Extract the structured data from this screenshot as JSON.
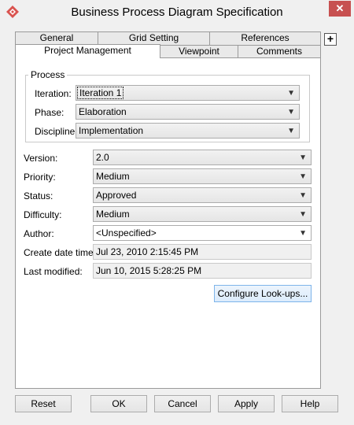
{
  "window": {
    "title": "Business Process Diagram Specification"
  },
  "titlebar": {
    "app_icon": "diamond-app-icon",
    "close_glyph": "✕"
  },
  "tabs_row1": [
    {
      "label": "General"
    },
    {
      "label": "Grid Setting"
    },
    {
      "label": "References"
    }
  ],
  "tabs_row2": [
    {
      "label": "Project Management",
      "active": true
    },
    {
      "label": "Viewpoint"
    },
    {
      "label": "Comments"
    }
  ],
  "maximize_glyph": "+",
  "process": {
    "legend": "Process",
    "iteration_label": "Iteration:",
    "iteration_value": "Iteration 1",
    "phase_label": "Phase:",
    "phase_value": "Elaboration",
    "discipline_label": "Discipline:",
    "discipline_value": "Implementation"
  },
  "fields": {
    "version_label": "Version:",
    "version_value": "2.0",
    "priority_label": "Priority:",
    "priority_value": "Medium",
    "status_label": "Status:",
    "status_value": "Approved",
    "difficulty_label": "Difficulty:",
    "difficulty_value": "Medium",
    "author_label": "Author:",
    "author_value": "<Unspecified>",
    "create_date_label": "Create date time:",
    "create_date_value": "Jul 23, 2010 2:15:45 PM",
    "last_modified_label": "Last modified:",
    "last_modified_value": "Jun 10, 2015 5:28:25 PM"
  },
  "configure_button": "Configure Look-ups...",
  "buttons": {
    "reset": "Reset",
    "ok": "OK",
    "cancel": "Cancel",
    "apply": "Apply",
    "help": "Help"
  },
  "dropdown_arrow": "▼",
  "colors": {
    "close": "#c75050",
    "icon": "#d9534f",
    "highlight_border": "#7eb4ea"
  }
}
